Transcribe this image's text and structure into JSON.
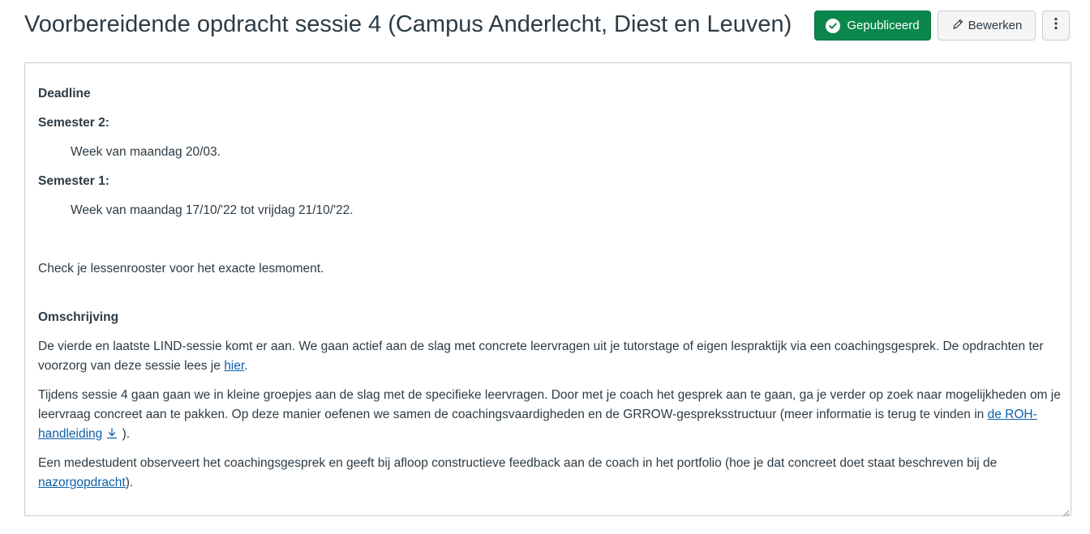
{
  "header": {
    "title": "Voorbereidende opdracht sessie 4 (Campus Anderlecht, Diest en Leuven)",
    "published_label": "Gepubliceerd",
    "edit_label": "Bewerken"
  },
  "content": {
    "deadline_heading": "Deadline",
    "semester2_label": "Semester 2:",
    "semester2_date": "Week van maandag 20/03.",
    "semester1_label": "Semester 1:",
    "semester1_date": "Week van maandag  17/10/'22 tot vrijdag 21/10/'22.",
    "check_text": "Check je lessenrooster voor het exacte lesmoment.",
    "description_heading": "Omschrijving",
    "p1_text": "De vierde en laatste LIND-sessie komt er aan. We gaan actief aan de slag met concrete leervragen uit je tutorstage of eigen lespraktijk via een coachingsgesprek. De opdrachten ter voorzorg van deze sessie lees je ",
    "p1_link": "hier",
    "p1_end": ".",
    "p2_text": "Tijdens sessie 4 gaan gaan we in kleine groepjes aan de slag met de specifieke leervragen. Door met je coach het gesprek aan te gaan, ga je verder op zoek naar mogelijkheden om je leervraag concreet aan te pakken. Op deze manier oefenen we samen de coachingsvaardigheden en de GRROW-gespreksstructuur (meer informatie is terug te vinden in ",
    "p2_link": "de ROH-handleiding",
    "p2_end": " ).",
    "p3_text": "Een medestudent observeert het coachingsgesprek en geeft bij afloop constructieve feedback aan de coach in het portfolio (hoe je dat concreet doet staat beschreven bij de ",
    "p3_link": "nazorgopdracht",
    "p3_end": ")."
  },
  "icons": {
    "published": "check-circle-icon",
    "edit": "pencil-icon",
    "more": "kebab-menu-icon",
    "download": "download-icon"
  },
  "colors": {
    "published_bg": "#0b874b",
    "link": "#0e5fa8",
    "text": "#2d3b45",
    "border": "#c7cdd1"
  }
}
